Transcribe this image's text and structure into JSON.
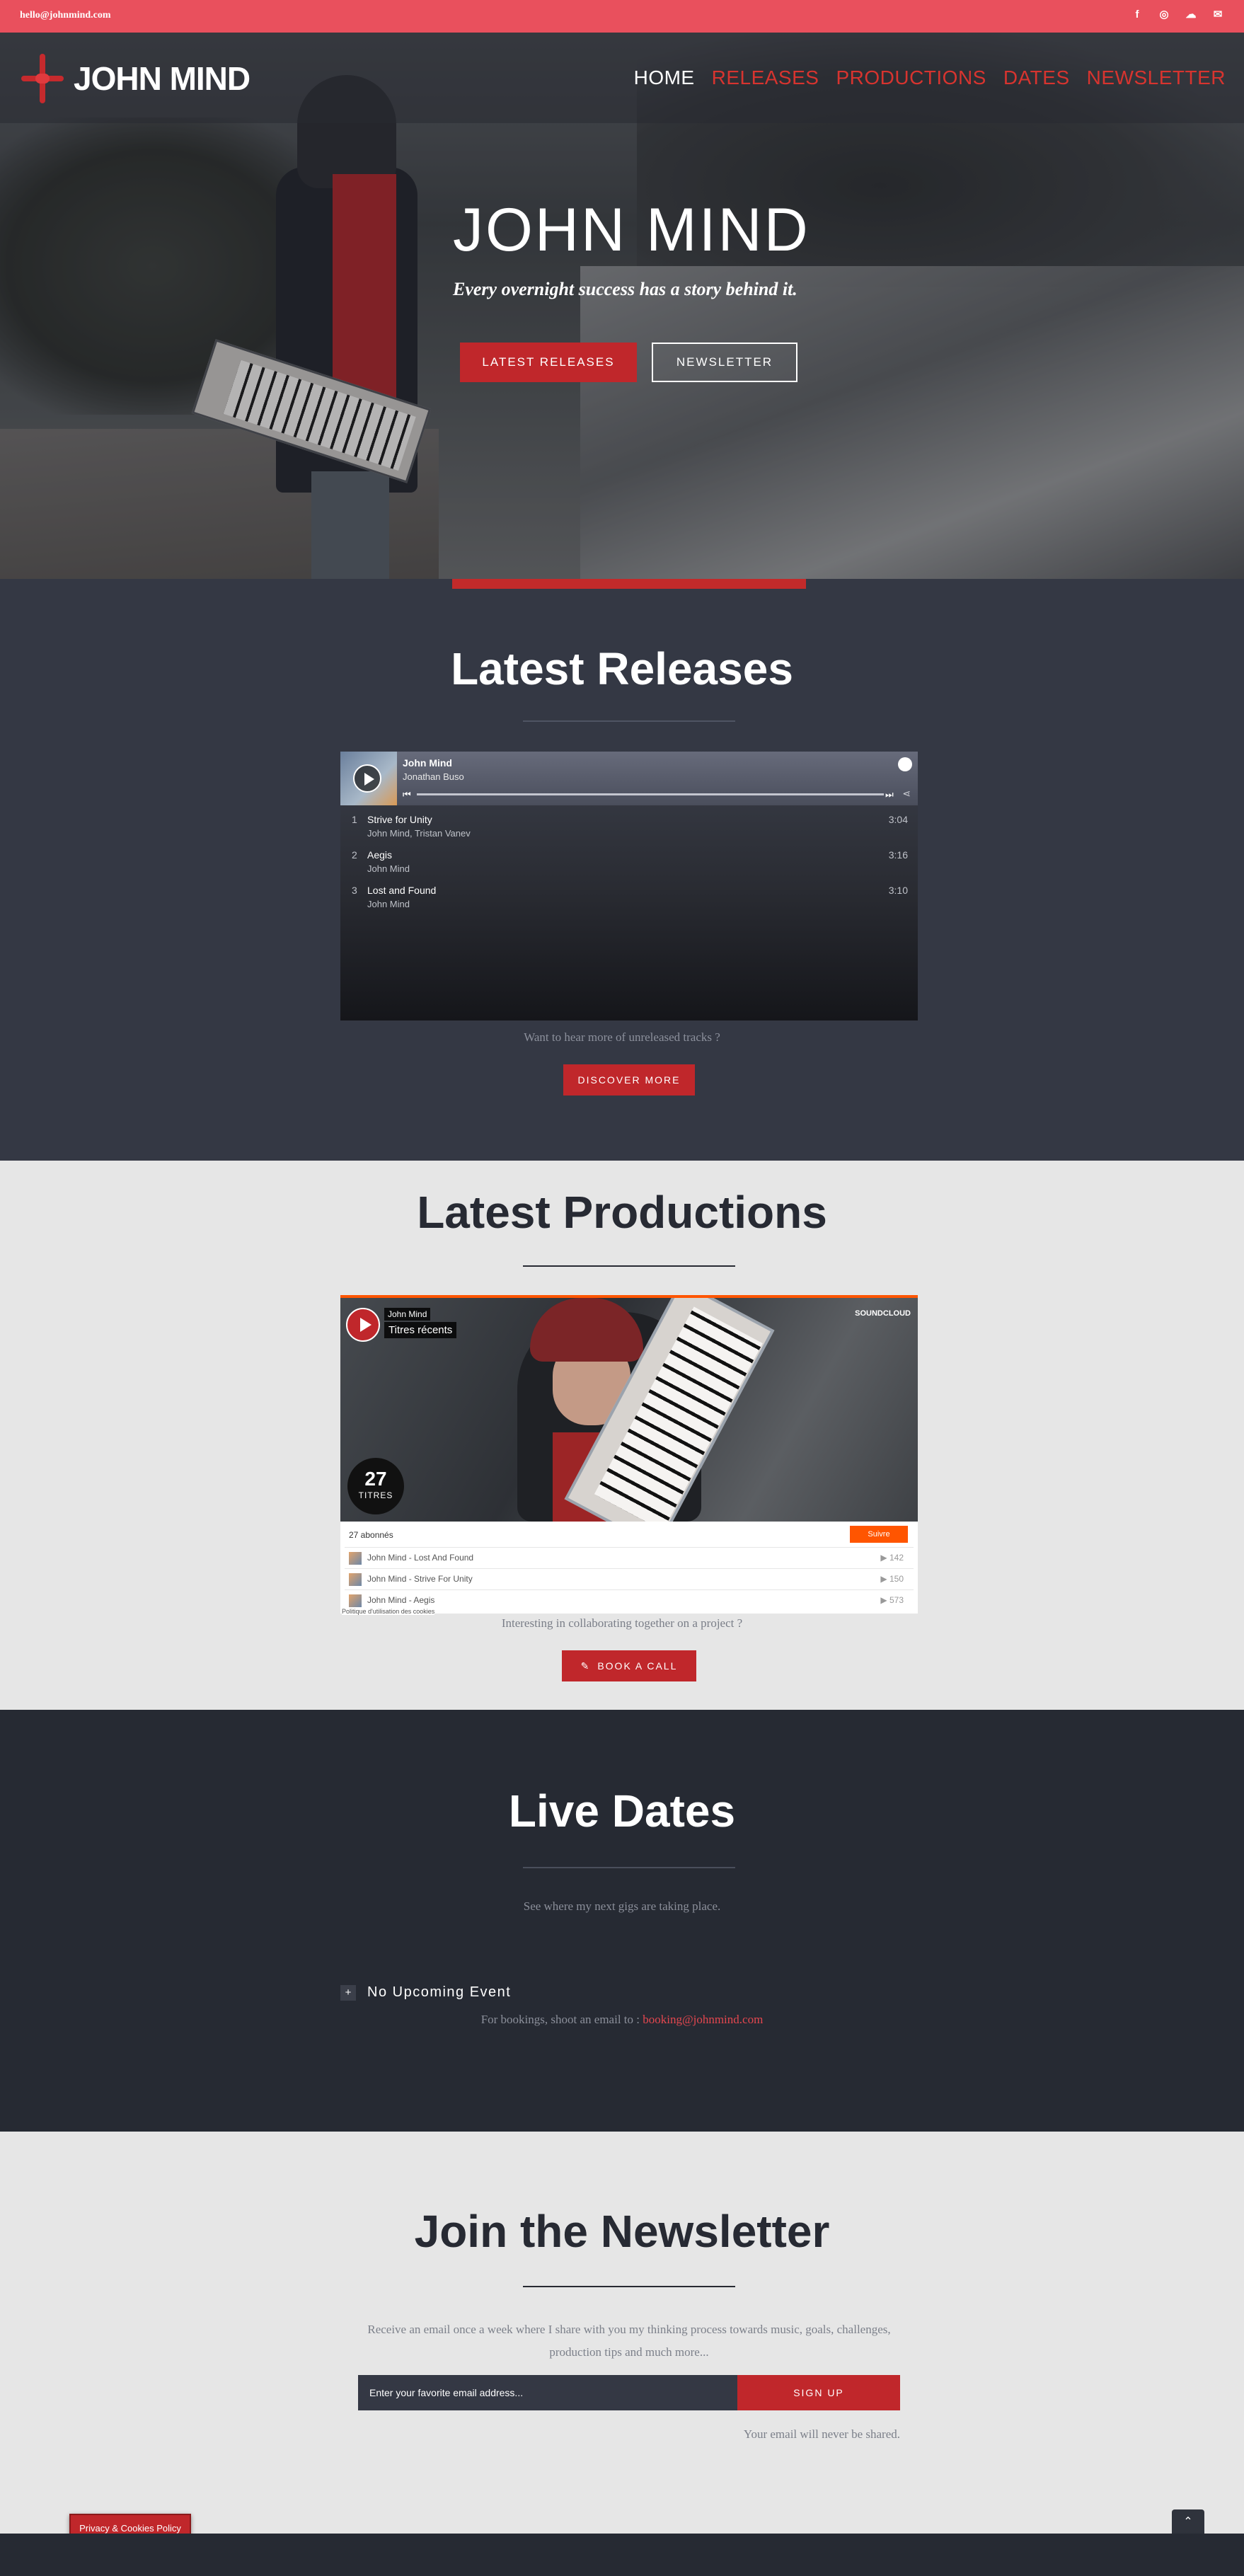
{
  "topbar": {
    "email": "hello@johnmind.com",
    "socials": [
      {
        "icon": "facebook-icon",
        "glyph": "f"
      },
      {
        "icon": "instagram-icon",
        "glyph": "◎"
      },
      {
        "icon": "soundcloud-icon",
        "glyph": "☁"
      },
      {
        "icon": "mail-icon",
        "glyph": "✉"
      }
    ]
  },
  "brand": {
    "logo_text": "JOHN MIND",
    "accent": "#c0272b",
    "topbar_color": "#e9505d"
  },
  "nav": {
    "items": [
      {
        "label": "HOME",
        "active": true
      },
      {
        "label": "RELEASES",
        "active": false
      },
      {
        "label": "PRODUCTIONS",
        "active": false
      },
      {
        "label": "DATES",
        "active": false
      },
      {
        "label": "NEWSLETTER",
        "active": false
      }
    ]
  },
  "hero": {
    "title": "JOHN MIND",
    "tagline": "Every overnight success has a story behind it.",
    "primary_button": "LATEST RELEASES",
    "secondary_button": "NEWSLETTER"
  },
  "releases": {
    "title": "Latest Releases",
    "player": {
      "artist": "John Mind",
      "subtitle": "Jonathan Buso",
      "tracks": [
        {
          "num": "1",
          "title": "Strive for Unity",
          "artists": "John Mind, Tristan Vanev",
          "duration": "3:04"
        },
        {
          "num": "2",
          "title": "Aegis",
          "artists": "John Mind",
          "duration": "3:16"
        },
        {
          "num": "3",
          "title": "Lost and Found",
          "artists": "John Mind",
          "duration": "3:10"
        }
      ]
    },
    "hint": "Want to hear more of unreleased tracks ?",
    "button": "DISCOVER MORE"
  },
  "productions": {
    "title": "Latest Productions",
    "soundcloud": {
      "user": "John Mind",
      "playlist_title": "Titres récents",
      "brand": "SOUNDCLOUD",
      "count": "27",
      "count_label": "TITRES",
      "followers": "27 abonnés",
      "follow_button": "Suivre",
      "tracks": [
        {
          "title": "John Mind - Lost And Found",
          "plays": "▶ 142"
        },
        {
          "title": "John Mind - Strive For Unity",
          "plays": "▶ 150"
        },
        {
          "title": "John Mind - Aegis",
          "plays": "▶ 573"
        }
      ],
      "cookie_link": "Politique d'utilisation des cookies"
    },
    "hint": "Interesting in collaborating together on a project ?",
    "button": "BOOK A CALL"
  },
  "dates": {
    "title": "Live Dates",
    "lead": "See where my next gigs are taking place.",
    "event": "No Upcoming Event",
    "booking_prefix": "For bookings, shoot an email to : ",
    "booking_email": "booking@johnmind.com"
  },
  "newsletter": {
    "title": "Join the Newsletter",
    "description": "Receive an email once a week where I share with you my thinking process towards music, goals, challenges, production tips and much more...",
    "placeholder": "Enter your favorite email address...",
    "button": "SIGN UP",
    "note": "Your email will never be shared."
  },
  "cookies": {
    "label": "Privacy & Cookies Policy"
  },
  "scroll_top": {
    "icon": "chevron-up-icon",
    "glyph": "⌃"
  }
}
